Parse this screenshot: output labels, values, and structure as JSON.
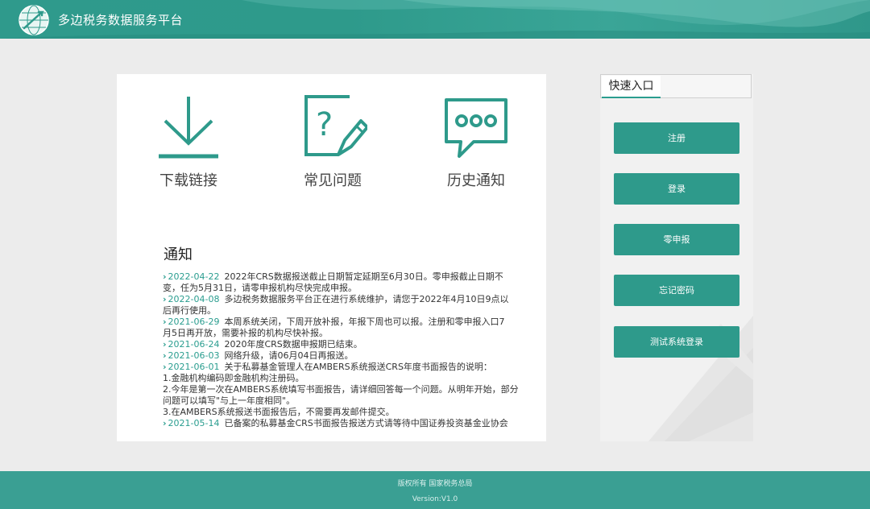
{
  "header": {
    "title": "多边税务数据服务平台"
  },
  "quick_links": {
    "download": "下载链接",
    "faq": "常见问题",
    "history": "历史通知"
  },
  "notice": {
    "title": "通知",
    "items": [
      {
        "date": "2022-04-22",
        "lines": [
          "2022年CRS数据报送截止日期暂定延期至6月30日。零申报截止日期不",
          "变，任为5月31日，请零申报机构尽快完成申报。"
        ]
      },
      {
        "date": "2022-04-08",
        "lines": [
          "多边税务数据服务平台正在进行系统维护，请您于2022年4月10日9点以",
          "后再行使用。"
        ]
      },
      {
        "date": "2021-06-29",
        "lines": [
          "本周系统关闭，下周开放补报，年报下周也可以报。注册和零申报入口7",
          "月5日再开放，需要补报的机构尽快补报。"
        ]
      },
      {
        "date": "2021-06-24",
        "lines": [
          "2020年度CRS数据申报期已结束。"
        ]
      },
      {
        "date": "2021-06-03",
        "lines": [
          "网络升级，请06月04日再报送。"
        ]
      },
      {
        "date": "2021-06-01",
        "lines": [
          "关于私募基金管理人在AMBERS系统报送CRS年度书面报告的说明：",
          "1.金融机构编码即金融机构注册码。",
          "2.今年是第一次在AMBERS系统填写书面报告，请详细回答每一个问题。从明年开始，部分",
          "问题可以填写\"与上一年度相同\"。",
          "3.在AMBERS系统报送书面报告后，不需要再发邮件提交。"
        ]
      },
      {
        "date": "2021-05-14",
        "lines": [
          "已备案的私募基金CRS书面报告报送方式请等待中国证券投资基金业协会"
        ]
      }
    ]
  },
  "side": {
    "tab_label": "快速入口",
    "buttons": [
      "注册",
      "登录",
      "零申报",
      "忘记密码",
      "测试系统登录"
    ]
  },
  "footer": {
    "copyright": "版权所有 国家税务总局",
    "version": "Version:V1.0"
  },
  "colors": {
    "accent": "#2e9a8b",
    "header": "#2f9a8c",
    "footer": "#3a9f93"
  }
}
